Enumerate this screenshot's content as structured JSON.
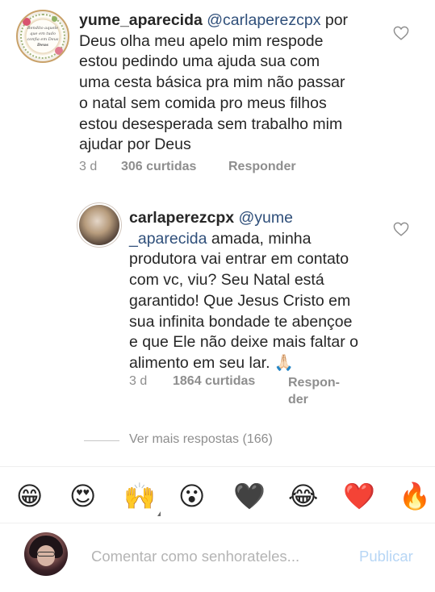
{
  "comments": [
    {
      "username": "yume_aparecida",
      "mention": "@carlaperezcpx",
      "lines": [
        " por",
        "Deus olha meu apelo mim respode",
        "estou pedindo uma ajuda sua com",
        "uma cesta básica pra mim não passar",
        "o natal sem comida pro meus filhos",
        "estou desesperada sem trabalho mim",
        "ajudar por Deus"
      ],
      "time": "3 d",
      "likes": "306 curtidas",
      "reply_label": "Responder",
      "avatar_text": "Bendito aquele que em tudo confia em Deus",
      "avatar_signature": "Deus"
    },
    {
      "username": "carlaperezcpx",
      "mention_line1": "@yume",
      "mention_line2": "_aparecida",
      "line2_rest": " amada, minha",
      "lines": [
        "produtora vai entrar em contato",
        "com vc, viu? Seu Natal está",
        "garantido! Que Jesus Cristo em",
        "sua infinita bondade te abençoe",
        "e que Ele não deixe mais faltar o",
        "alimento em seu lar. 🙏🏻"
      ],
      "time": "3 d",
      "likes": "1864 curtidas",
      "reply_label_1": "Respon-",
      "reply_label_2": "der"
    }
  ],
  "view_more": "Ver mais respostas (166)",
  "emojis": [
    {
      "icon": "grinning-face-icon",
      "glyph": "😁"
    },
    {
      "icon": "heart-eyes-icon",
      "glyph": "😍"
    },
    {
      "icon": "raising-hands-icon",
      "glyph": "🙌"
    },
    {
      "icon": "surprised-face-icon",
      "glyph": "😮"
    },
    {
      "icon": "black-heart-icon",
      "glyph": "🖤"
    },
    {
      "icon": "tears-of-joy-icon",
      "glyph": "😂"
    },
    {
      "icon": "red-heart-icon",
      "glyph": "❤️"
    },
    {
      "icon": "fire-icon",
      "glyph": "🔥"
    }
  ],
  "composer": {
    "placeholder": "Comentar como senhorateles...",
    "post_label": "Publicar"
  },
  "colors": {
    "text": "#262626",
    "mention": "#2f4f7a",
    "meta": "#8e8e8e",
    "post_disabled": "#b7d6f5"
  }
}
